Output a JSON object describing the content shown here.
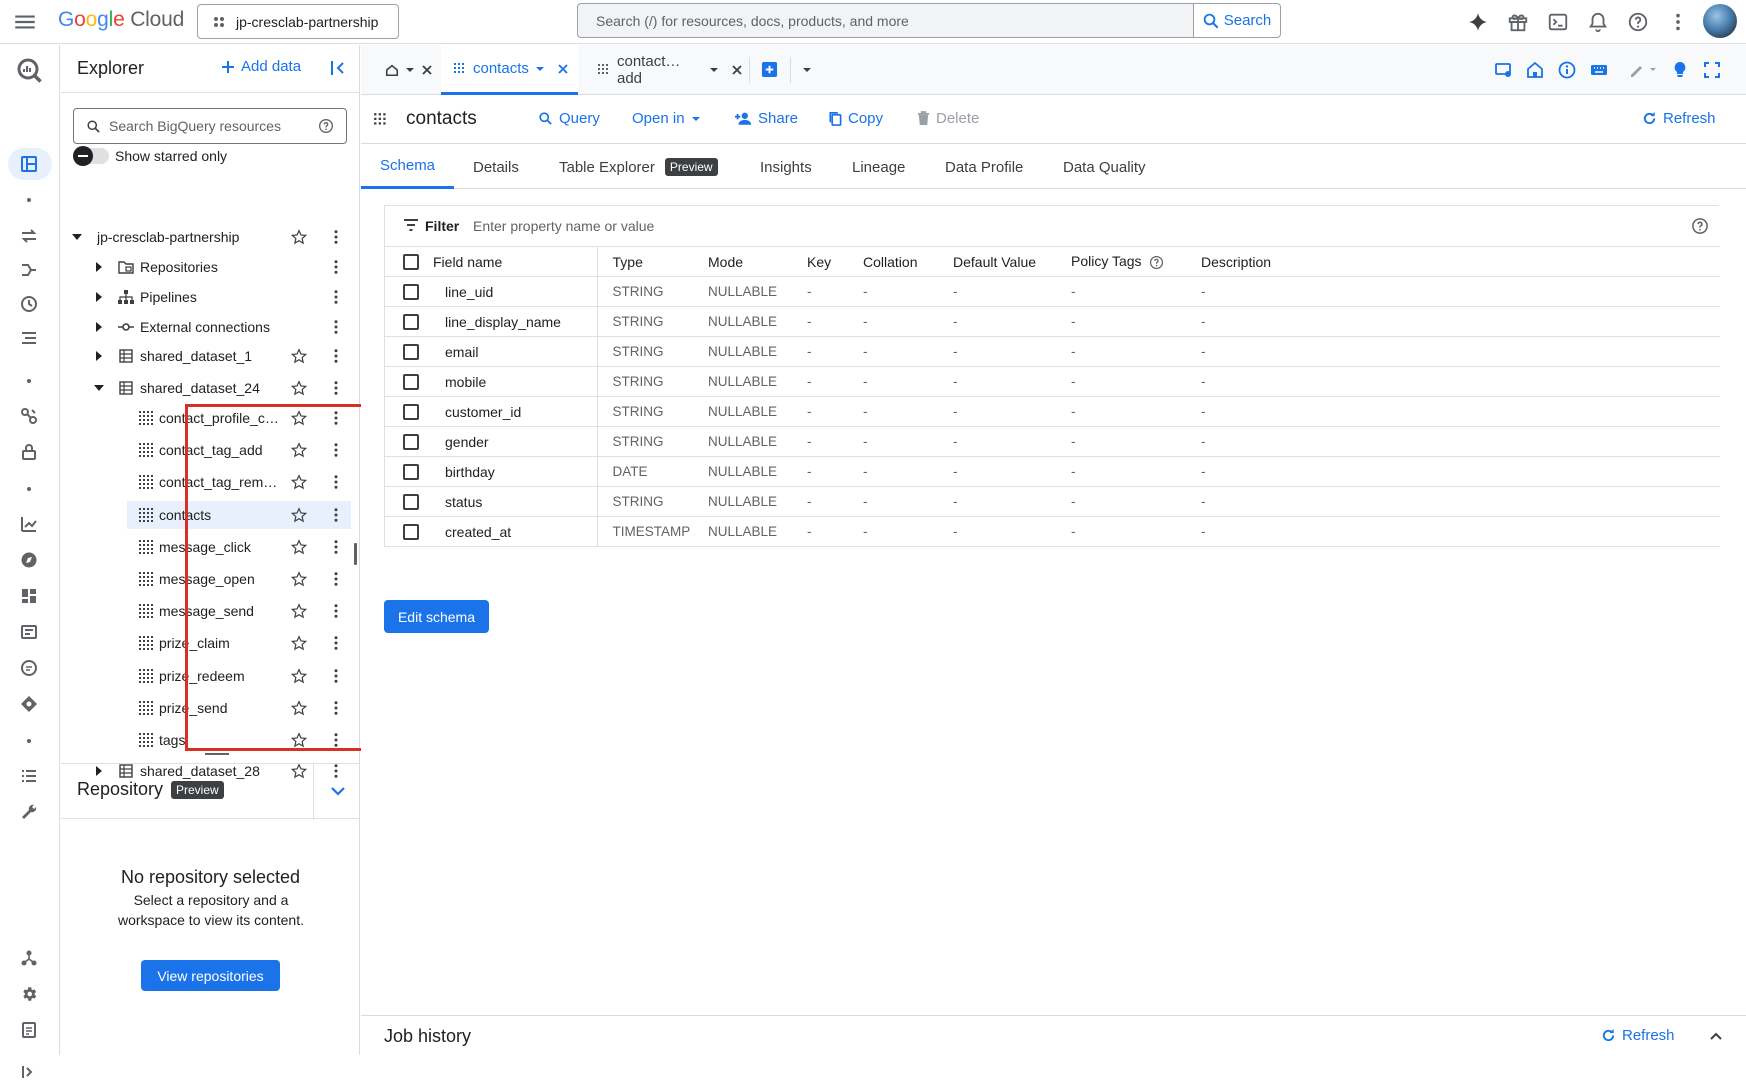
{
  "topbar": {
    "logo": {
      "g1": "G",
      "g2": "o",
      "g3": "o",
      "g4": "g",
      "g5": "l",
      "g6": "e",
      "cloud": "Cloud"
    },
    "project": "jp-cresclab-partnership",
    "search_placeholder": "Search (/) for resources, docs, products, and more",
    "search_button": "Search",
    "icons": [
      "gemini-icon",
      "gift-icon",
      "cloud-shell-icon",
      "notifications-icon",
      "help-icon",
      "more-vert-icon"
    ]
  },
  "explorer": {
    "title": "Explorer",
    "add_data": "Add data",
    "search_placeholder": "Search BigQuery resources",
    "starred_label": "Show starred only",
    "project": "jp-cresclab-partnership",
    "sections": [
      {
        "label": "Repositories",
        "icon": "repositories-icon"
      },
      {
        "label": "Pipelines",
        "icon": "pipelines-icon"
      },
      {
        "label": "External connections",
        "icon": "connections-icon"
      }
    ],
    "datasets_top": [
      {
        "label": "shared_dataset_1",
        "expanded": false
      },
      {
        "label": "shared_dataset_24",
        "expanded": true
      }
    ],
    "tables": [
      "contact_profile_c…",
      "contact_tag_add",
      "contact_tag_rem…",
      "contacts",
      "message_click",
      "message_open",
      "message_send",
      "prize_claim",
      "prize_redeem",
      "prize_send",
      "tags"
    ],
    "selected_table": "contacts",
    "datasets_bottom": [
      {
        "label": "shared_dataset_28",
        "expanded": false
      }
    ]
  },
  "repository": {
    "title": "Repository",
    "chip": "Preview",
    "empty_title": "No repository selected",
    "empty_desc": "Select a repository and a workspace to view its content.",
    "button": "View repositories"
  },
  "tabs": {
    "items": [
      {
        "label": "contacts",
        "active": true
      },
      {
        "label": "contact…add",
        "active": false
      }
    ]
  },
  "table_header": {
    "title": "contacts",
    "actions": {
      "query": "Query",
      "open_in": "Open in",
      "share": "Share",
      "copy": "Copy",
      "delete": "Delete",
      "refresh": "Refresh"
    }
  },
  "subtabs": {
    "schema": "Schema",
    "details": "Details",
    "explorer": "Table Explorer",
    "explorer_chip": "Preview",
    "insights": "Insights",
    "lineage": "Lineage",
    "profile": "Data Profile",
    "quality": "Data Quality",
    "active": "Schema"
  },
  "schema": {
    "filter_label": "Filter",
    "filter_placeholder": "Enter property name or value",
    "columns": [
      "Field name",
      "Type",
      "Mode",
      "Key",
      "Collation",
      "Default Value",
      "Policy Tags",
      "Description"
    ],
    "rows": [
      [
        "line_uid",
        "STRING",
        "NULLABLE",
        "-",
        "-",
        "-",
        "-",
        "-"
      ],
      [
        "line_display_name",
        "STRING",
        "NULLABLE",
        "-",
        "-",
        "-",
        "-",
        "-"
      ],
      [
        "email",
        "STRING",
        "NULLABLE",
        "-",
        "-",
        "-",
        "-",
        "-"
      ],
      [
        "mobile",
        "STRING",
        "NULLABLE",
        "-",
        "-",
        "-",
        "-",
        "-"
      ],
      [
        "customer_id",
        "STRING",
        "NULLABLE",
        "-",
        "-",
        "-",
        "-",
        "-"
      ],
      [
        "gender",
        "STRING",
        "NULLABLE",
        "-",
        "-",
        "-",
        "-",
        "-"
      ],
      [
        "birthday",
        "DATE",
        "NULLABLE",
        "-",
        "-",
        "-",
        "-",
        "-"
      ],
      [
        "status",
        "STRING",
        "NULLABLE",
        "-",
        "-",
        "-",
        "-",
        "-"
      ],
      [
        "created_at",
        "TIMESTAMP",
        "NULLABLE",
        "-",
        "-",
        "-",
        "-",
        "-"
      ]
    ],
    "edit_button": "Edit schema"
  },
  "job_history": {
    "title": "Job history",
    "refresh": "Refresh"
  },
  "colors": {
    "accent": "#1a73e8",
    "highlight": "#d93025",
    "selected_bg": "#e8f0fe"
  }
}
